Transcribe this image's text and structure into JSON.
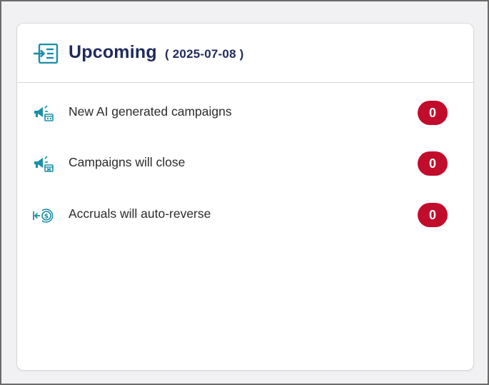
{
  "card": {
    "title": "Upcoming",
    "date": "( 2025-07-08 )"
  },
  "items": [
    {
      "label": "New AI generated campaigns",
      "count": "0",
      "icon": "campaign-megaphone-icon"
    },
    {
      "label": "Campaigns will close",
      "count": "0",
      "icon": "campaign-close-icon"
    },
    {
      "label": "Accruals will auto-reverse",
      "count": "0",
      "icon": "auto-reverse-icon"
    }
  ],
  "colors": {
    "title": "#1f2a5c",
    "icon": "#1a8fa8",
    "badge": "#c10c2b"
  }
}
